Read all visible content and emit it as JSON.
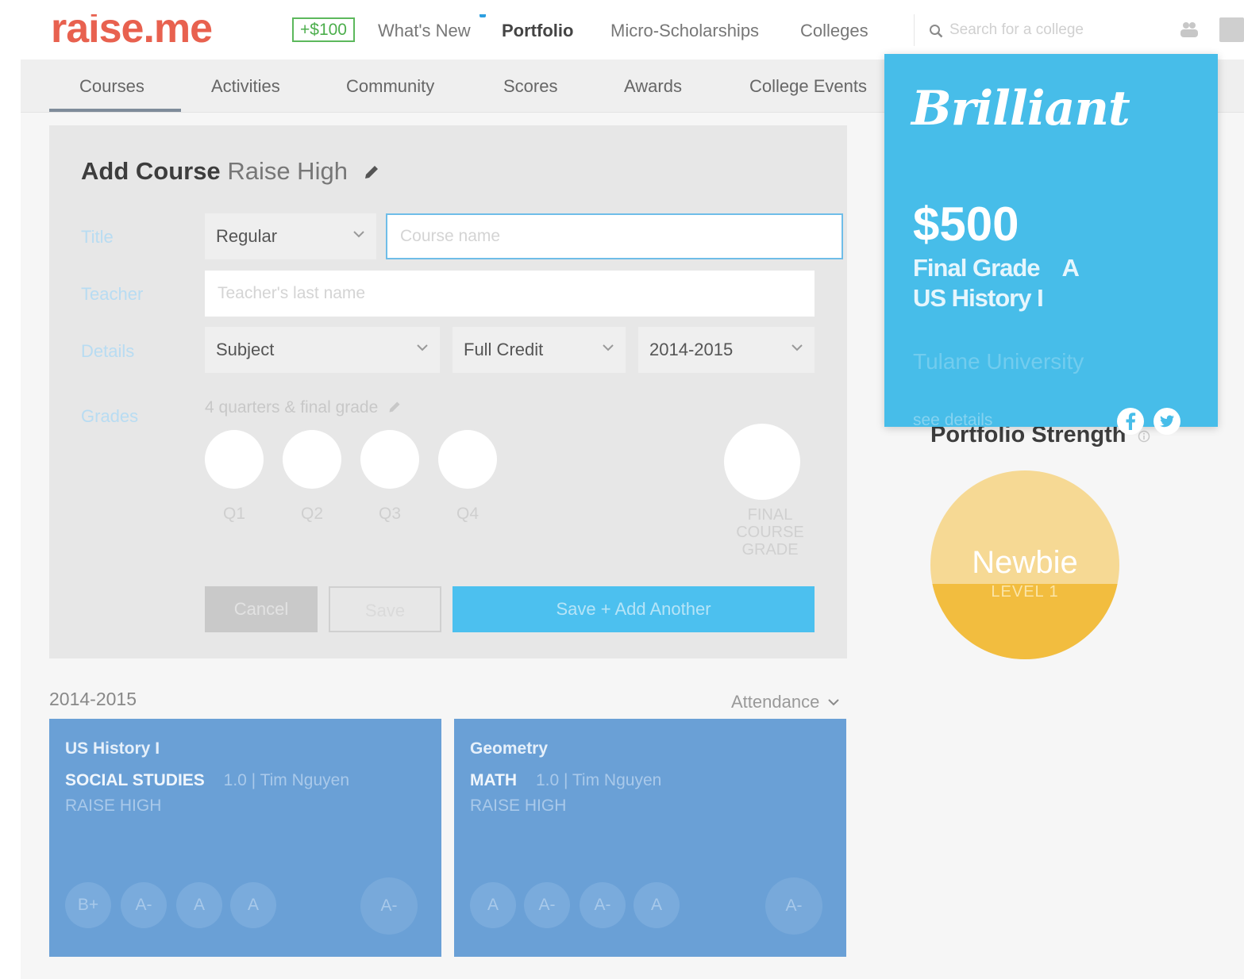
{
  "topnav": {
    "logo": "raise.me",
    "badge": "+$100",
    "links": [
      "What's New",
      "Portfolio",
      "Micro-Scholarships",
      "Colleges"
    ],
    "search_placeholder": "Search for a college"
  },
  "subnav": {
    "tabs": [
      "Courses",
      "Activities",
      "Community",
      "Scores",
      "Awards",
      "College Events"
    ],
    "active_tab": "Courses"
  },
  "form": {
    "title_bold": "Add Course",
    "title_school": "Raise High",
    "labels": {
      "title": "Title",
      "teacher": "Teacher",
      "details": "Details",
      "grades": "Grades"
    },
    "level_select": "Regular",
    "course_placeholder": "Course name",
    "teacher_placeholder": "Teacher's last name",
    "subject_select": "Subject",
    "credit_select": "Full Credit",
    "year_select": "2014-2015",
    "grades_hint": "4 quarters & final grade",
    "quarters": [
      "Q1",
      "Q2",
      "Q3",
      "Q4"
    ],
    "final_label": "FINAL COURSE GRADE",
    "cancel": "Cancel",
    "save": "Save",
    "save_add": "Save + Add Another"
  },
  "courses": {
    "year": "2014-2015",
    "attendance": "Attendance",
    "cards": [
      {
        "title": "US History I",
        "subject": "SOCIAL STUDIES",
        "meta": "1.0 | Tim Nguyen",
        "school": "RAISE HIGH",
        "grades": [
          "B+",
          "A-",
          "A",
          "A"
        ],
        "final": "A-"
      },
      {
        "title": "Geometry",
        "subject": "MATH",
        "meta": "1.0 | Tim Nguyen",
        "school": "RAISE HIGH",
        "grades": [
          "A",
          "A-",
          "A-",
          "A"
        ],
        "final": "A-"
      }
    ]
  },
  "award": {
    "title": "Brilliant",
    "amount": "$500",
    "grade_label": "Final Grade",
    "grade_value": "A",
    "course": "US History I",
    "college": "Tulane University",
    "details_link": "see details"
  },
  "portfolio": {
    "title": "Portfolio Strength",
    "level_name": "Newbie",
    "level": "LEVEL 1",
    "fill_fraction": 0.4
  },
  "colors": {
    "brand_red": "#e8614f",
    "accent_blue": "#4cc0ef",
    "card_blue": "#6aa0d6",
    "award_blue": "#47bde9",
    "strength_gold": "#f2bd3f"
  }
}
